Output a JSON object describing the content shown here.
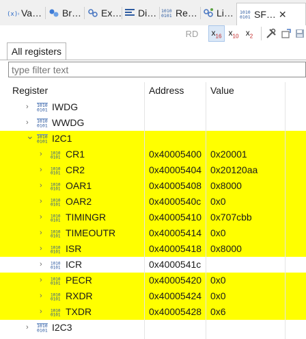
{
  "tabs": [
    {
      "label": "Va…",
      "icon": "variables-icon"
    },
    {
      "label": "Br…",
      "icon": "breakpoints-icon"
    },
    {
      "label": "Ex…",
      "icon": "expressions-icon"
    },
    {
      "label": "Di…",
      "icon": "disassembly-icon"
    },
    {
      "label": "Re…",
      "icon": "registers-icon"
    },
    {
      "label": "Li…",
      "icon": "live-expressions-icon"
    },
    {
      "label": "SF…",
      "icon": "sfr-icon",
      "active": true
    }
  ],
  "toolbar": {
    "rd_label": "RD",
    "hex_label": "x16",
    "dec_label": "x10",
    "bin_label": "x2"
  },
  "view_tab": "All registers",
  "filter": {
    "placeholder": "type filter text"
  },
  "columns": {
    "register": "Register",
    "address": "Address",
    "value": "Value"
  },
  "rows": [
    {
      "name": "IWDG",
      "address": "",
      "value": "",
      "kind": "group",
      "expanded": false,
      "highlight": false
    },
    {
      "name": "WWDG",
      "address": "",
      "value": "",
      "kind": "group",
      "expanded": false,
      "highlight": false
    },
    {
      "name": "I2C1",
      "address": "",
      "value": "",
      "kind": "group",
      "expanded": true,
      "highlight": true
    },
    {
      "name": "CR1",
      "address": "0x40005400",
      "value": "0x20001",
      "kind": "register",
      "highlight": true
    },
    {
      "name": "CR2",
      "address": "0x40005404",
      "value": "0x20120aa",
      "kind": "register",
      "highlight": true
    },
    {
      "name": "OAR1",
      "address": "0x40005408",
      "value": "0x8000",
      "kind": "register",
      "highlight": true
    },
    {
      "name": "OAR2",
      "address": "0x4000540c",
      "value": "0x0",
      "kind": "register",
      "highlight": true
    },
    {
      "name": "TIMINGR",
      "address": "0x40005410",
      "value": "0x707cbb",
      "kind": "register",
      "highlight": true
    },
    {
      "name": "TIMEOUTR",
      "address": "0x40005414",
      "value": "0x0",
      "kind": "register",
      "highlight": true
    },
    {
      "name": "ISR",
      "address": "0x40005418",
      "value": "0x8000",
      "kind": "register",
      "highlight": true
    },
    {
      "name": "ICR",
      "address": "0x4000541c",
      "value": "",
      "kind": "register",
      "highlight": false
    },
    {
      "name": "PECR",
      "address": "0x40005420",
      "value": "0x0",
      "kind": "register",
      "highlight": true
    },
    {
      "name": "RXDR",
      "address": "0x40005424",
      "value": "0x0",
      "kind": "register",
      "highlight": true
    },
    {
      "name": "TXDR",
      "address": "0x40005428",
      "value": "0x6",
      "kind": "register",
      "highlight": true
    },
    {
      "name": "I2C3",
      "address": "",
      "value": "",
      "kind": "group",
      "expanded": false,
      "highlight": false
    }
  ],
  "colors": {
    "highlight": "#ffff00",
    "selected_tab_bg": "#ffffff",
    "pressed_button": "#dbe8f7"
  }
}
